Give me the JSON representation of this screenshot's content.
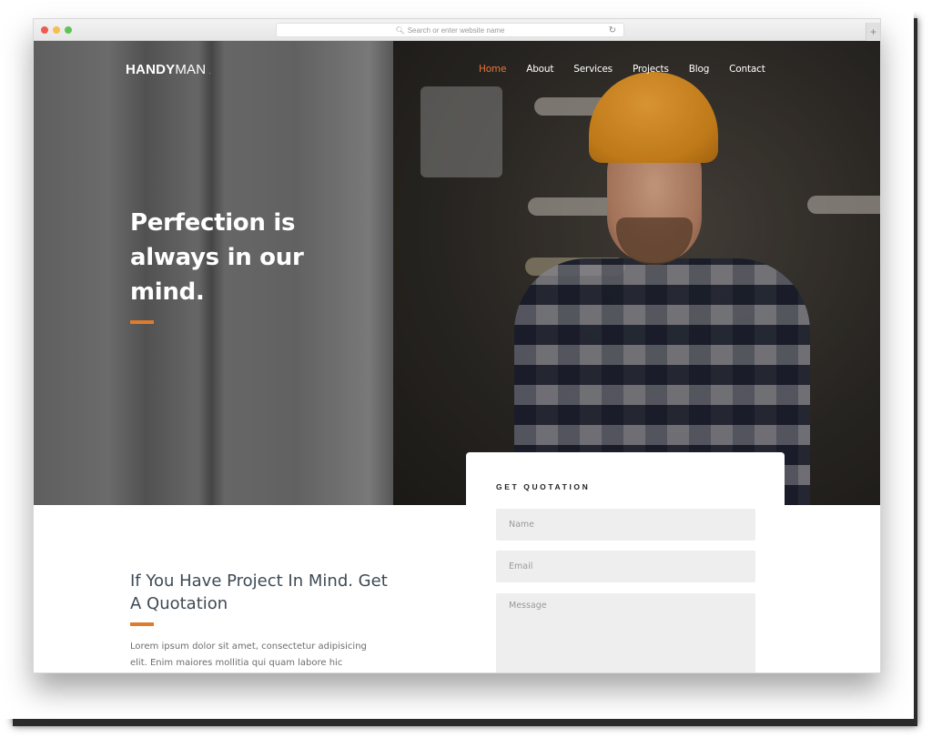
{
  "browser": {
    "url_placeholder": "Search or enter website name",
    "search_icon": "search-icon",
    "reload_icon": "reload-icon",
    "new_tab_icon": "plus-icon",
    "traffic_lights": [
      "close",
      "minimize",
      "maximize"
    ]
  },
  "header": {
    "logo_bold": "HANDY",
    "logo_light": "MAN",
    "logo_dot": ".",
    "nav": [
      {
        "label": "Home",
        "active": true
      },
      {
        "label": "About",
        "active": false
      },
      {
        "label": "Services",
        "active": false
      },
      {
        "label": "Projects",
        "active": false
      },
      {
        "label": "Blog",
        "active": false
      },
      {
        "label": "Contact",
        "active": false
      }
    ]
  },
  "hero": {
    "title": "Perfection is always in our mind."
  },
  "intro": {
    "title": "If You Have Project In Mind. Get A Quotation",
    "body": "Lorem ipsum dolor sit amet, consectetur adipisicing elit. Enim maiores mollitia qui quam labore hic"
  },
  "quote_form": {
    "title": "GET QUOTATION",
    "name_placeholder": "Name",
    "email_placeholder": "Email",
    "message_placeholder": "Message"
  },
  "colors": {
    "accent": "#e07b2c",
    "nav_active": "#e8743b",
    "heading_text": "#3d4a55"
  }
}
